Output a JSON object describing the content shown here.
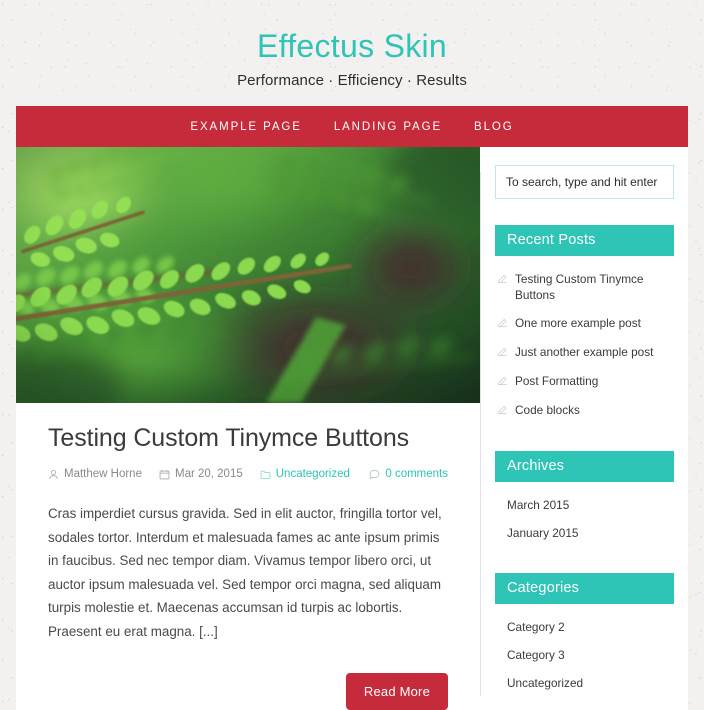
{
  "site": {
    "title": "Effectus Skin",
    "tagline": "Performance · Efficiency · Results",
    "accent_teal": "#2ec4b6",
    "accent_red": "#c62b3c",
    "background": "#f2f1ef"
  },
  "nav": {
    "items": [
      {
        "label": "Example Page"
      },
      {
        "label": "Landing Page"
      },
      {
        "label": "Blog"
      }
    ]
  },
  "post": {
    "featured_image_alt": "Close-up of green fern fronds",
    "title": "Testing Custom Tinymce Buttons",
    "meta": {
      "author": "Matthew Horne",
      "date": "Mar 20, 2015",
      "category": "Uncategorized",
      "comments": "0 comments"
    },
    "excerpt": "Cras imperdiet cursus gravida. Sed in elit auctor, fringilla tortor vel, sodales tortor. Interdum et malesuada fames ac ante ipsum primis in faucibus. Sed nec tempor diam. Vivamus tempor libero orci, ut auctor ipsum malesuada vel. Sed tempor orci magna, sed aliquam turpis molestie et. Maecenas accumsan id turpis ac lobortis. Praesent eu erat magna. [...]",
    "read_more": "Read More"
  },
  "sidebar": {
    "search": {
      "placeholder": "To search, type and hit enter",
      "value": ""
    },
    "widgets": [
      {
        "title": "Recent Posts",
        "icon": "pencil-icon",
        "items": [
          {
            "label": "Testing Custom Tinymce Buttons"
          },
          {
            "label": "One more example post"
          },
          {
            "label": "Just another example post"
          },
          {
            "label": "Post Formatting"
          },
          {
            "label": "Code blocks"
          }
        ]
      },
      {
        "title": "Archives",
        "icon": "none",
        "items": [
          {
            "label": "March 2015"
          },
          {
            "label": "January 2015"
          }
        ]
      },
      {
        "title": "Categories",
        "icon": "none",
        "items": [
          {
            "label": "Category 2"
          },
          {
            "label": "Category 3"
          },
          {
            "label": "Uncategorized"
          }
        ]
      }
    ]
  }
}
